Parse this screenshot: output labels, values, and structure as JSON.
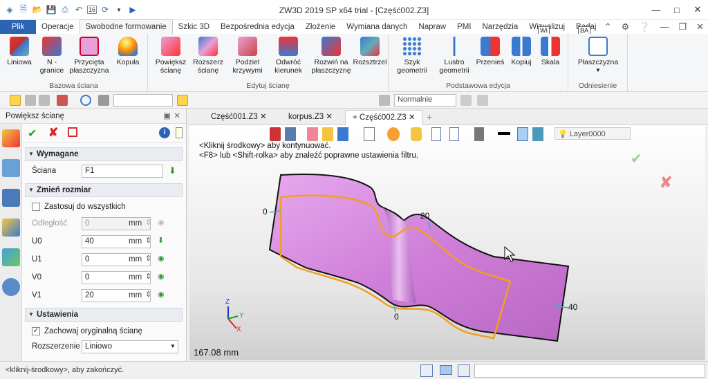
{
  "window": {
    "title": "ZW3D 2019 SP x64 trial - [Część002.Z3]",
    "quick_num": "16",
    "controls": [
      "—",
      "□",
      "✕"
    ]
  },
  "menu_tabs": [
    "Plik",
    "Operacje",
    "Swobodne formowanie",
    "Szkic 3D",
    "Bezpośrednia edycja",
    "Złożenie",
    "Wymiana danych",
    "Napraw",
    "PMI",
    "Narzędzia",
    "Wizualizuj",
    "Badaj"
  ],
  "tooltips": {
    "wi": "WI",
    "ba": "BA"
  },
  "ribbon": {
    "groups": [
      {
        "title": "Bazowa ściana",
        "buttons": [
          {
            "label": "Liniowa",
            "icon": "linear-face-icon"
          },
          {
            "label": "N - granice",
            "icon": "n-sided-icon"
          },
          {
            "label": "Przycięta płaszczyzna",
            "icon": "trimmed-plane-icon"
          },
          {
            "label": "Kopuła",
            "icon": "dome-icon"
          }
        ]
      },
      {
        "title": "Edytuj ścianę",
        "buttons": [
          {
            "label": "Powiększ ścianę",
            "icon": "extend-face-icon"
          },
          {
            "label": "Rozszerz ścianę",
            "icon": "expand-face-icon"
          },
          {
            "label": "Podziel krzywymi",
            "icon": "split-curves-icon"
          },
          {
            "label": "Odwróć kierunek",
            "icon": "reverse-direction-icon"
          },
          {
            "label": "Rozwiń na płaszczyznę",
            "icon": "unfold-icon"
          },
          {
            "label": "Rozsztrzel",
            "icon": "explode-icon"
          }
        ]
      },
      {
        "title": "Podstawowa edycja",
        "buttons": [
          {
            "label": "Szyk geometrii",
            "icon": "pattern-icon"
          },
          {
            "label": "Lustro geometrii",
            "icon": "mirror-icon"
          },
          {
            "label": "Przenieś",
            "icon": "move-icon"
          },
          {
            "label": "Kopiuj",
            "icon": "copy-icon"
          },
          {
            "label": "Skala",
            "icon": "scale-icon"
          }
        ]
      },
      {
        "title": "Odniesienie",
        "buttons": [
          {
            "label": "Płaszczyzna",
            "icon": "plane-icon"
          }
        ]
      }
    ]
  },
  "toolbar": {
    "filter_value": "",
    "mode_value": "Normalnie"
  },
  "panel": {
    "title": "Powiększ ścianę",
    "sections": {
      "required": "Wymagane",
      "resize": "Zmień rozmiar",
      "settings": "Ustawienia"
    },
    "face_label": "Ściana",
    "face_value": "F1",
    "apply_all_label": "Zastosuj do wszystkich",
    "rows": [
      {
        "label": "Odległość",
        "value": "0",
        "unit": "mm",
        "disabled": true
      },
      {
        "label": "U0",
        "value": "40",
        "unit": "mm"
      },
      {
        "label": "U1",
        "value": "0",
        "unit": "mm"
      },
      {
        "label": "V0",
        "value": "0",
        "unit": "mm"
      },
      {
        "label": "V1",
        "value": "20",
        "unit": "mm"
      }
    ],
    "keep_original_label": "Zachowaj oryginalną ścianę",
    "extension_label": "Rozszerzenie",
    "extension_value": "Liniowo"
  },
  "doc_tabs": [
    {
      "label": "Część001.Z3",
      "active": false
    },
    {
      "label": "korpus.Z3",
      "active": false
    },
    {
      "label": "Część002.Z3",
      "active": true
    }
  ],
  "viewport": {
    "layer": "Layer0000",
    "msg1": "<Kliknij środkowy> aby kontynuować.",
    "msg2": "<F8> lub <Shift-rolka> aby znaleźć poprawne ustawienia filtru.",
    "dims": {
      "left": "0",
      "top": "20",
      "bottom": "0",
      "right": "40"
    },
    "axes": {
      "x": "X",
      "y": "Y",
      "z": "Z"
    },
    "scale": "167.08 mm",
    "colors": {
      "surface": "#cf7fd8",
      "boundary": "#f0a020"
    }
  },
  "status": {
    "hint": "<kliknij-środkowy>, aby zakończyć."
  }
}
